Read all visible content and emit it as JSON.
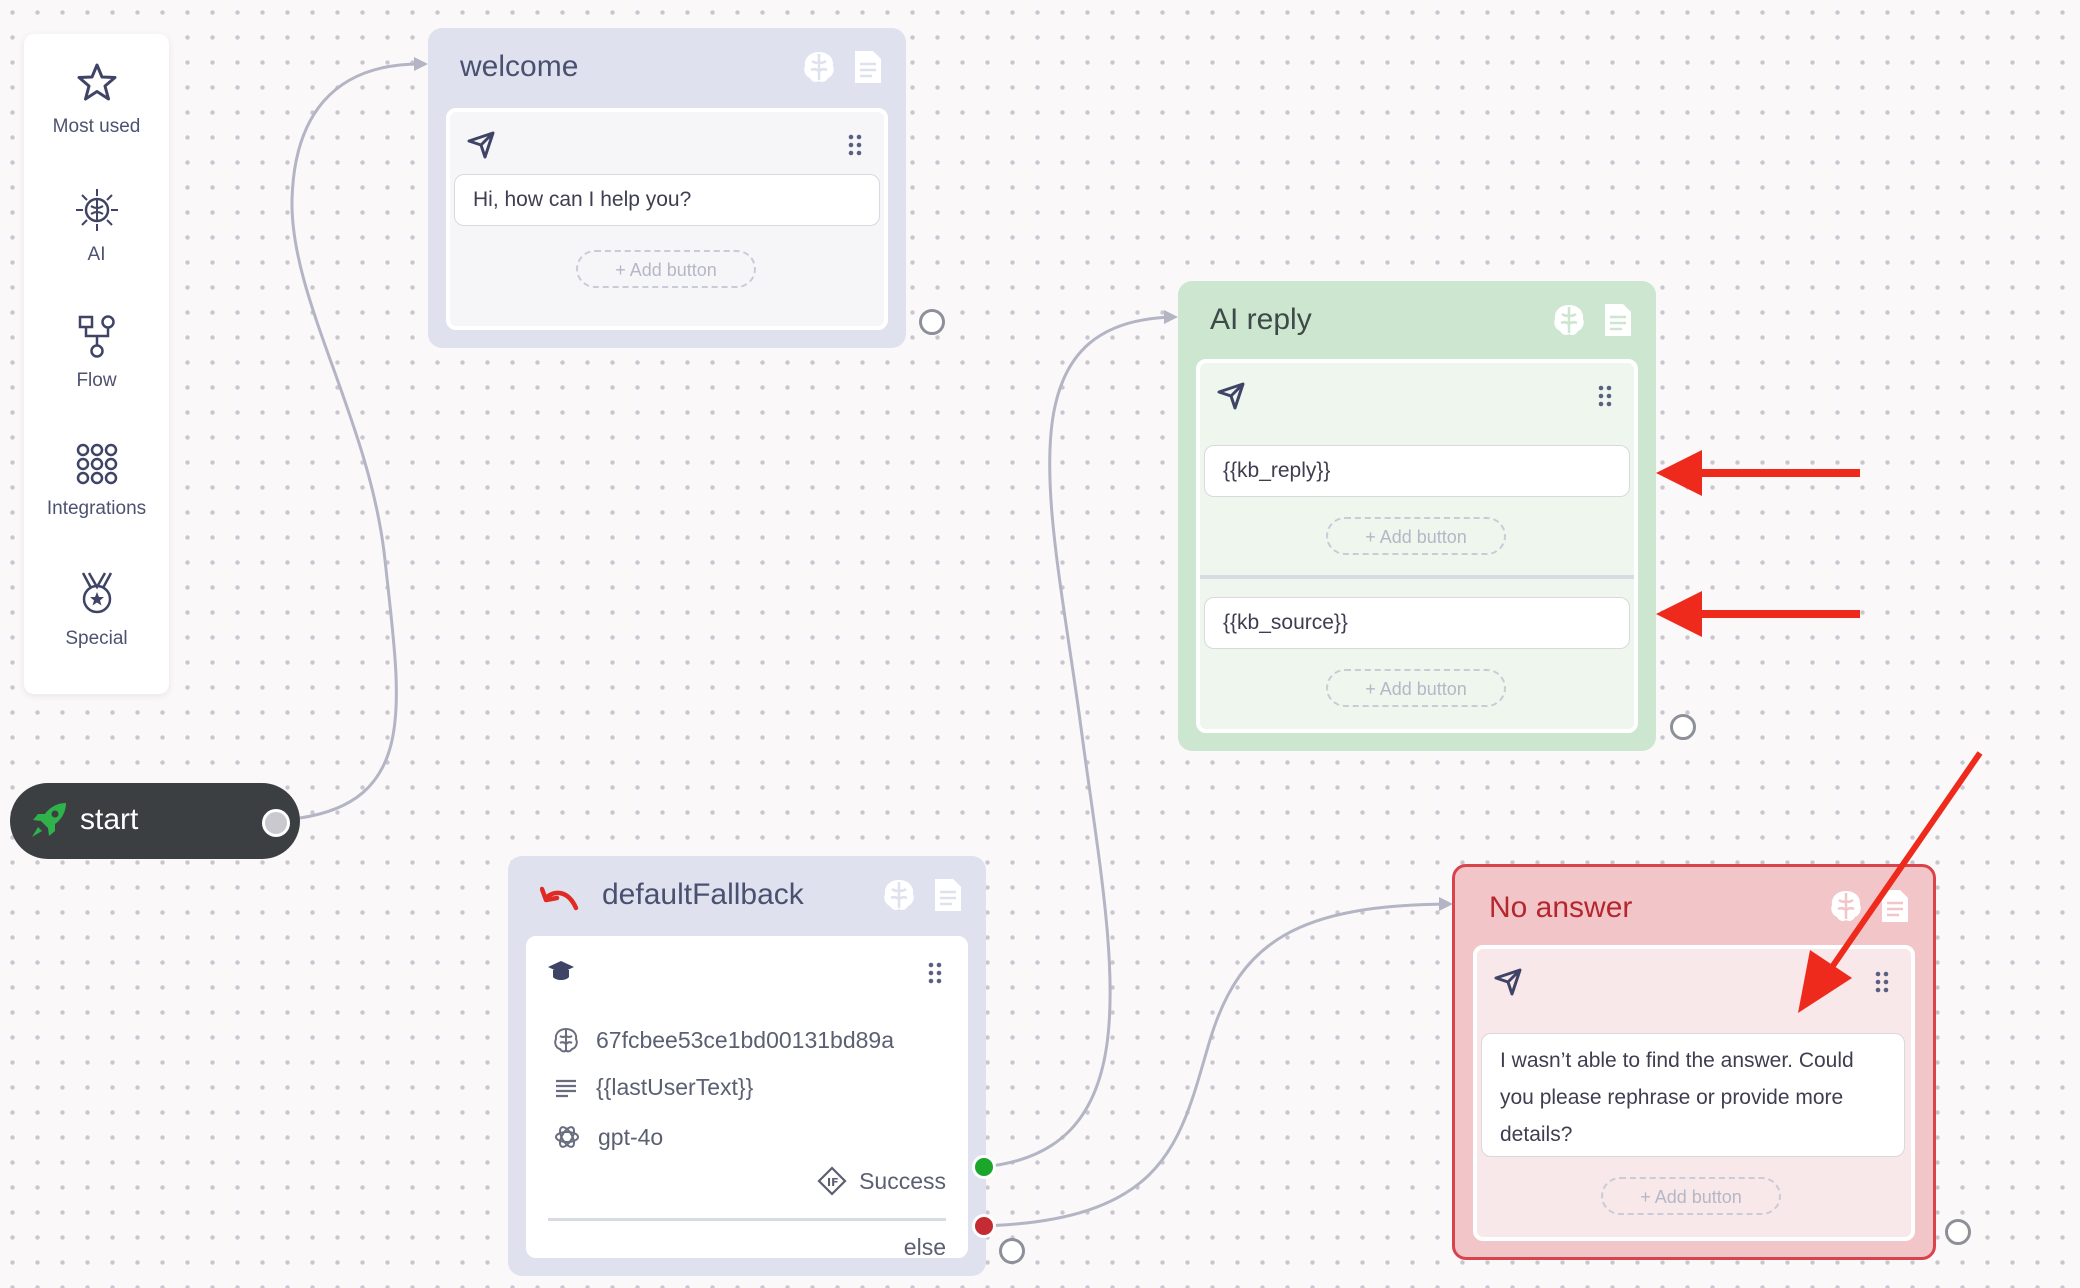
{
  "sidebar": {
    "items": [
      {
        "label": "Most used",
        "icon": "star-icon"
      },
      {
        "label": "AI",
        "icon": "ai-brain-icon"
      },
      {
        "label": "Flow",
        "icon": "flow-icon"
      },
      {
        "label": "Integrations",
        "icon": "grid-dots-icon"
      },
      {
        "label": "Special",
        "icon": "medal-icon"
      }
    ]
  },
  "start_node": {
    "label": "start"
  },
  "welcome": {
    "title": "welcome",
    "message": "Hi, how can I help you?",
    "add_button": "+ Add button"
  },
  "ai_reply": {
    "title": "AI reply",
    "message1": "{{kb_reply}}",
    "message2": "{{kb_source}}",
    "add_button": "+ Add button"
  },
  "default_fallback": {
    "title": "defaultFallback",
    "knowledge_base_id": "67fcbee53ce1bd00131bd89a",
    "input_variable": "{{lastUserText}}",
    "model": "gpt-4o",
    "success_label": "Success",
    "else_label": "else"
  },
  "no_answer": {
    "title": "No answer",
    "message": "I wasn’t able to find the answer. Could you please rephrase or provide more details?",
    "add_button": "+ Add button"
  },
  "colors": {
    "welcome_bg": "#dfe2ee",
    "ai_reply_bg": "#cce6d0",
    "no_answer_bg": "#f2c6c9",
    "no_answer_border": "#d9434c",
    "arrow": "#ee2a1c",
    "success_dot": "#1aa52b",
    "else_dot": "#c42b32"
  }
}
